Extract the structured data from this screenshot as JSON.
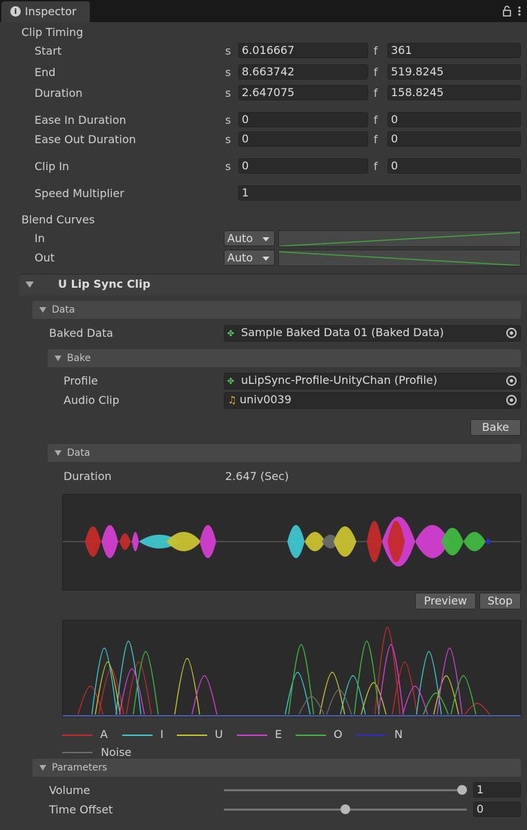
{
  "window": {
    "tab_title": "Inspector",
    "info_icon": "info-icon",
    "lock_icon": "lock-icon",
    "menu_icon": "kebab-menu-icon"
  },
  "clip_timing": {
    "header": "Clip Timing",
    "rows": [
      {
        "label": "Start",
        "s_unit": "s",
        "s_value": "6.016667",
        "f_unit": "f",
        "f_value": "361"
      },
      {
        "label": "End",
        "s_unit": "s",
        "s_value": "8.663742",
        "f_unit": "f",
        "f_value": "519.8245"
      },
      {
        "label": "Duration",
        "s_unit": "s",
        "s_value": "2.647075",
        "f_unit": "f",
        "f_value": "158.8245"
      },
      {
        "label": "Ease In Duration",
        "s_unit": "s",
        "s_value": "0",
        "f_unit": "f",
        "f_value": "0"
      },
      {
        "label": "Ease Out Duration",
        "s_unit": "s",
        "s_value": "0",
        "f_unit": "f",
        "f_value": "0"
      },
      {
        "label": "Clip In",
        "s_unit": "s",
        "s_value": "0",
        "f_unit": "f",
        "f_value": "0"
      }
    ],
    "speed_label": "Speed Multiplier",
    "speed_value": "1"
  },
  "blend_curves": {
    "header": "Blend Curves",
    "in_label": "In",
    "in_mode": "Auto",
    "out_label": "Out",
    "out_mode": "Auto",
    "curve_color": "#3fa83a"
  },
  "component": {
    "title": "U Lip Sync Clip"
  },
  "data_section": {
    "header": "Data",
    "baked_data_label": "Baked Data",
    "baked_data_value": "Sample Baked Data 01 (Baked Data)",
    "bake_section": {
      "header": "Bake",
      "profile_label": "Profile",
      "profile_value": "uLipSync-Profile-UnityChan (Profile)",
      "audio_label": "Audio Clip",
      "audio_value": "univ0039",
      "bake_button": "Bake"
    },
    "inner_data": {
      "header": "Data",
      "duration_label": "Duration",
      "duration_value": "2.647 (Sec)",
      "preview_button": "Preview",
      "stop_button": "Stop"
    }
  },
  "legend": [
    {
      "name": "A",
      "color": "#c42a2a"
    },
    {
      "name": "I",
      "color": "#3ec6cf"
    },
    {
      "name": "U",
      "color": "#c9c232"
    },
    {
      "name": "E",
      "color": "#d23ed2"
    },
    {
      "name": "O",
      "color": "#3fb83f"
    },
    {
      "name": "N",
      "color": "#2c2ccf"
    },
    {
      "name": "Noise",
      "color": "#6a6a6a"
    }
  ],
  "parameters": {
    "header": "Parameters",
    "volume_label": "Volume",
    "volume_value": "1",
    "volume_fraction": 1.0,
    "offset_label": "Time Offset",
    "offset_value": "0",
    "offset_fraction": 0.5
  }
}
